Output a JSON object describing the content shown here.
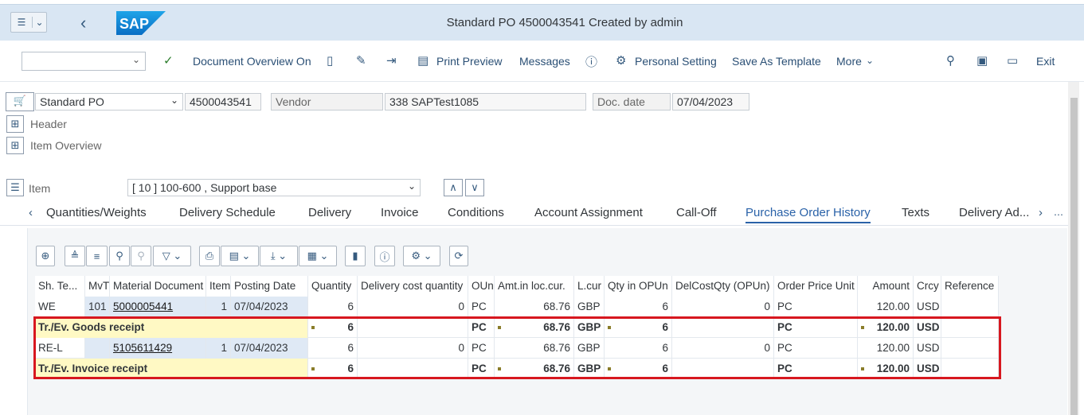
{
  "window": {
    "title": "Standard PO 4500043541 Created by admin",
    "logo_text": "SAP"
  },
  "toolbar": {
    "items": [
      "Document Overview On",
      "Print Preview",
      "Messages",
      "Personal Setting",
      "Save As Template",
      "More",
      "Exit"
    ]
  },
  "header": {
    "po_type": "Standard PO",
    "po_number": "4500043541",
    "vendor_label": "Vendor",
    "vendor_value": "338 SAPTest1085",
    "docdate_label": "Doc. date",
    "docdate_value": "07/04/2023",
    "header_label": "Header",
    "item_overview_label": "Item Overview",
    "item_label": "Item",
    "item_value": "[ 10 ] 100-600 , Support base"
  },
  "tabs": [
    "Quantities/Weights",
    "Delivery Schedule",
    "Delivery",
    "Invoice",
    "Conditions",
    "Account Assignment",
    "Call-Off",
    "Purchase Order History",
    "Texts",
    "Delivery Ad..."
  ],
  "active_tab": "Purchase Order History",
  "columns": [
    "Sh. Te...",
    "MvT",
    "Material Document",
    "Item",
    "Posting Date",
    "Quantity",
    "Delivery cost quantity",
    "OUn",
    "Amt.in loc.cur.",
    "L.cur",
    "Qty in OPUn",
    "DelCostQty (OPUn)",
    "Order Price Unit",
    "Amount",
    "Crcy",
    "Reference"
  ],
  "rows": [
    {
      "sh": "WE",
      "mvt": "101",
      "doc": "5000005441",
      "item": "1",
      "date": "07/04/2023",
      "qty": "6",
      "dcq": "0",
      "oun": "PC",
      "amt": "68.76",
      "lcur": "GBP",
      "qopun": "6",
      "dcqo": "0",
      "opu": "PC",
      "amount": "120.00",
      "crcy": "USD",
      "ref": ""
    },
    {
      "sh": "Tr./Ev. Goods receipt",
      "mvt": "",
      "doc": "",
      "item": "",
      "date": "",
      "qty": "6",
      "dcq": "",
      "oun": "PC",
      "amt": "68.76",
      "lcur": "GBP",
      "qopun": "6",
      "dcqo": "",
      "opu": "PC",
      "amount": "120.00",
      "crcy": "USD",
      "ref": ""
    },
    {
      "sh": "RE-L",
      "mvt": "",
      "doc": "5105611429",
      "item": "1",
      "date": "07/04/2023",
      "qty": "6",
      "dcq": "0",
      "oun": "PC",
      "amt": "68.76",
      "lcur": "GBP",
      "qopun": "6",
      "dcqo": "0",
      "opu": "PC",
      "amount": "120.00",
      "crcy": "USD",
      "ref": ""
    },
    {
      "sh": "Tr./Ev. Invoice receipt",
      "mvt": "",
      "doc": "",
      "item": "",
      "date": "",
      "qty": "6",
      "dcq": "",
      "oun": "PC",
      "amt": "68.76",
      "lcur": "GBP",
      "qopun": "6",
      "dcqo": "",
      "opu": "PC",
      "amount": "120.00",
      "crcy": "USD",
      "ref": ""
    }
  ]
}
